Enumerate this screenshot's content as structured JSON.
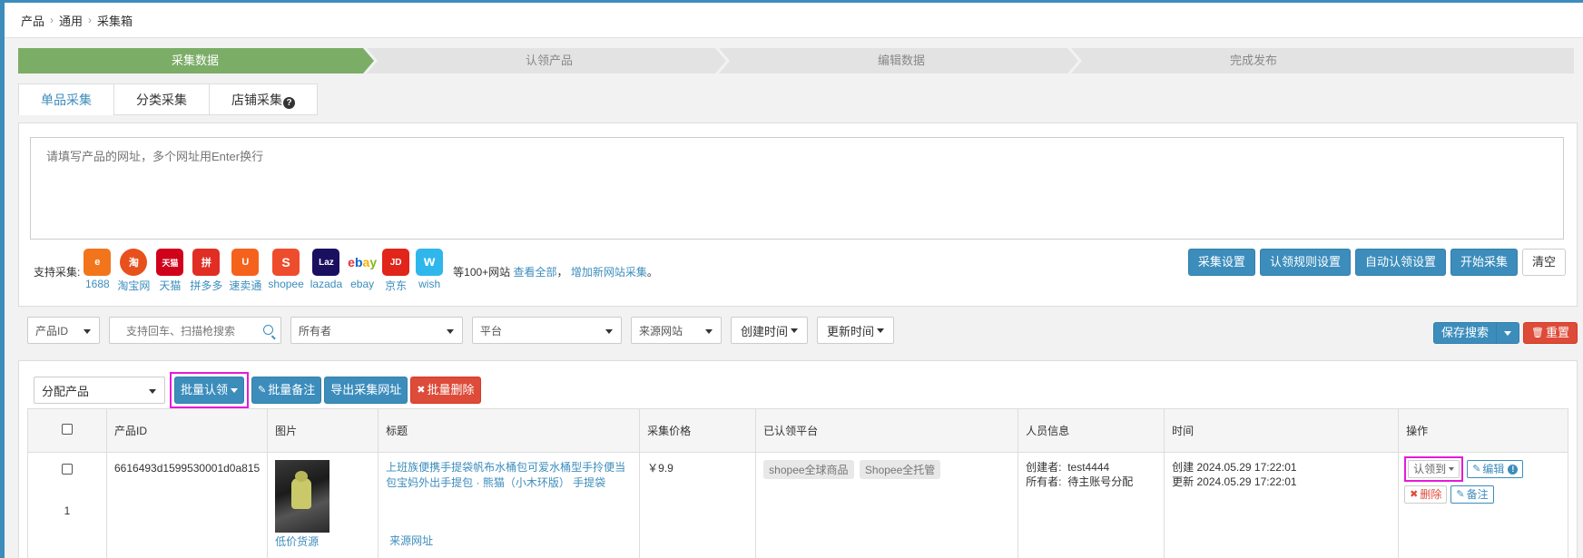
{
  "breadcrumb": [
    "产品",
    "通用",
    "采集箱"
  ],
  "steps": [
    "采集数据",
    "认领产品",
    "编辑数据",
    "完成发布"
  ],
  "tabs": [
    "单品采集",
    "分类采集",
    "店铺采集"
  ],
  "url_input": {
    "placeholder": "请填写产品的网址，多个网址用Enter换行"
  },
  "support": {
    "label": "支持采集:",
    "platforms": [
      {
        "name": "1688",
        "color": "#f2751c",
        "glyph": "e"
      },
      {
        "name": "淘宝网",
        "color": "#e8501c",
        "glyph": "淘"
      },
      {
        "name": "天猫",
        "color": "#d0021b",
        "glyph": "天猫"
      },
      {
        "name": "拼多多",
        "color": "#e02e24",
        "glyph": "拼"
      },
      {
        "name": "速卖通",
        "color": "#f5621c",
        "glyph": "U"
      },
      {
        "name": "shopee",
        "color": "#ee4d2d",
        "glyph": "S"
      },
      {
        "name": "lazada",
        "color": "#1a1060",
        "glyph": "Laz"
      },
      {
        "name": "ebay",
        "color": "#ffffff",
        "glyph": "ebay"
      },
      {
        "name": "京东",
        "color": "#e1251b",
        "glyph": "JD"
      },
      {
        "name": "wish",
        "color": "#2fb7ec",
        "glyph": "w"
      }
    ],
    "more_prefix": "等100+网站",
    "view_all": "查看全部",
    "sep": "，",
    "add_site": "增加新网站采集",
    "end": "。"
  },
  "actions": {
    "collect_settings": "采集设置",
    "claim_rules": "认领规则设置",
    "auto_claim": "自动认领设置",
    "start_collect": "开始采集",
    "clear": "清空"
  },
  "filters": {
    "product_id": "产品ID",
    "search_placeholder": "支持回车、扫描枪搜索",
    "owner": "所有者",
    "platform": "平台",
    "source": "来源网站",
    "created_time": "创建时间",
    "updated_time": "更新时间",
    "save_search": "保存搜索",
    "reset": "重置"
  },
  "toolbar": {
    "assign": "分配产品",
    "batch_claim": "批量认领",
    "batch_note": "批量备注",
    "export_urls": "导出采集网址",
    "batch_delete": "批量删除"
  },
  "table": {
    "headers": [
      "产品ID",
      "图片",
      "标题",
      "采集价格",
      "已认领平台",
      "人员信息",
      "时间",
      "操作"
    ],
    "rows": [
      {
        "index": "1",
        "product_id": "6616493d1599530001d0a815",
        "image_caption": "低价货源",
        "title": "上班族便携手提袋帆布水桶包可爱水桶型手拎便当包宝妈外出手提包 · 熊猫（小木环版） 手提袋",
        "source_link": "来源网址",
        "price": "￥9.9",
        "platforms": [
          "shopee全球商品",
          "Shopee全托管"
        ],
        "creator_label": "创建者:",
        "creator": "test4444",
        "owner_label": "所有者:",
        "owner": "待主账号分配",
        "created": "创建 2024.05.29 17:22:01",
        "updated": "更新 2024.05.29 17:22:01",
        "op_claim_to": "认领到",
        "op_edit": "编辑",
        "op_delete": "删除",
        "op_note": "备注"
      }
    ]
  },
  "colors": {
    "accent": "#3c8dbc",
    "step_active": "#7cad67",
    "danger": "#dd4b39",
    "highlight": "#e619d9"
  }
}
